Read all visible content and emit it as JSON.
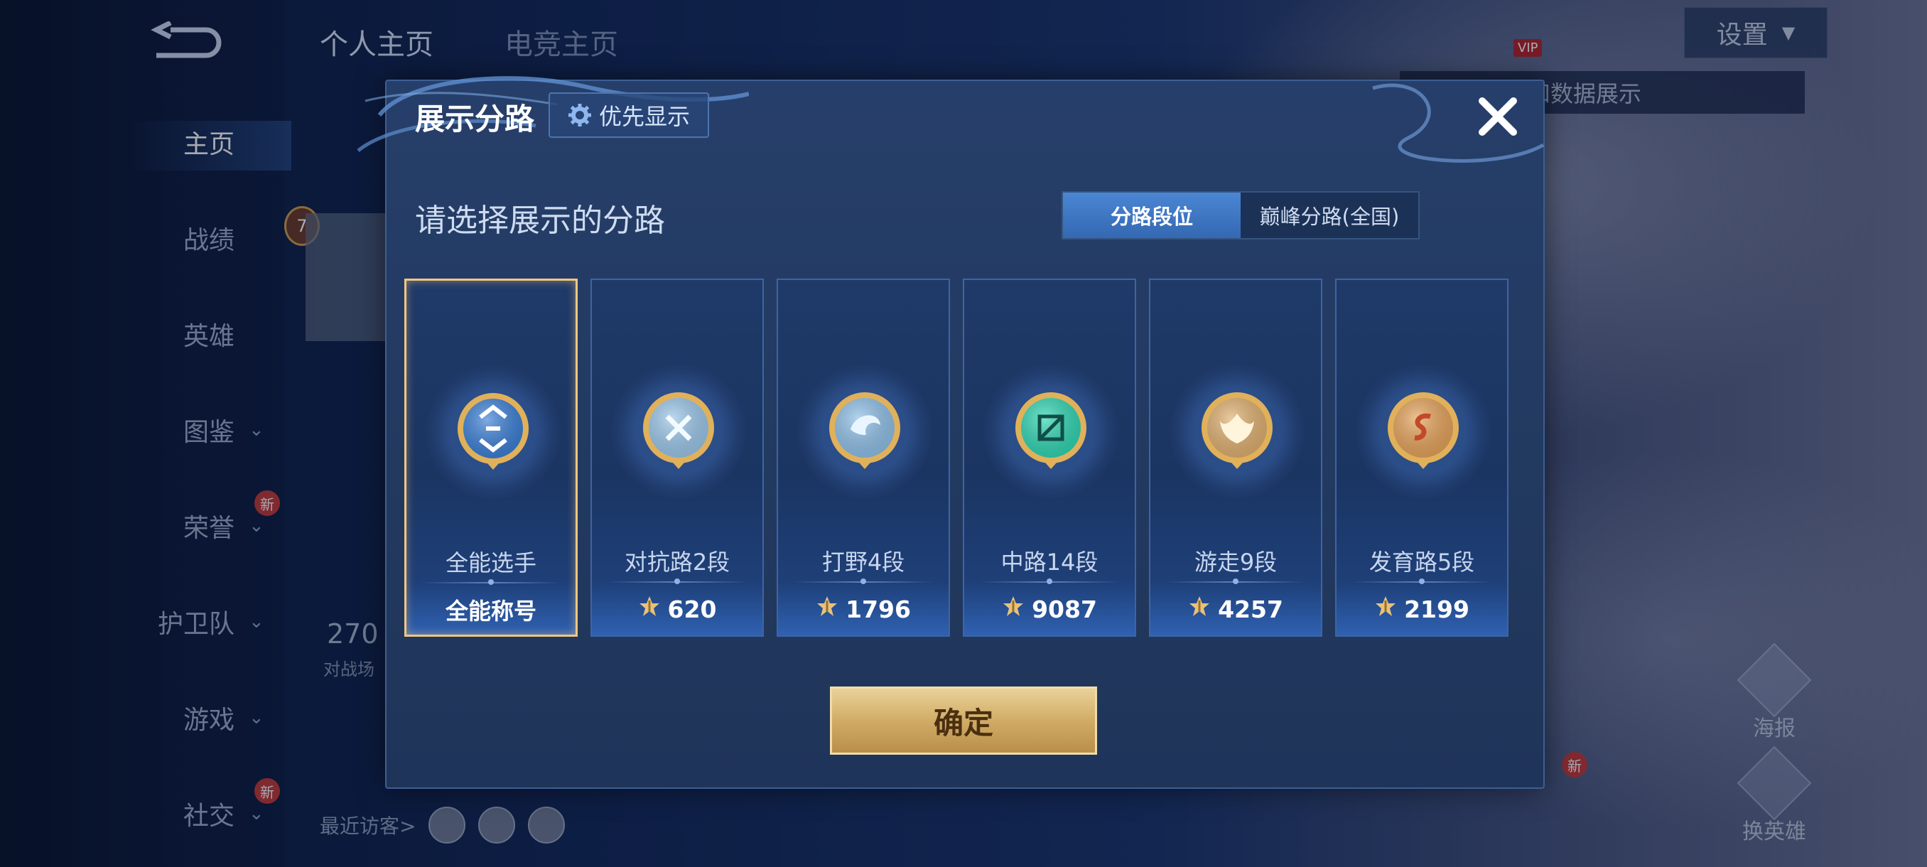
{
  "background": {
    "tabs": [
      "个人主页",
      "电竞主页"
    ],
    "nav": [
      {
        "label": "主页",
        "active": true,
        "chevron": false,
        "new": false
      },
      {
        "label": "战绩",
        "active": false,
        "chevron": false,
        "new": false
      },
      {
        "label": "英雄",
        "active": false,
        "chevron": false,
        "new": false
      },
      {
        "label": "图鉴",
        "active": false,
        "chevron": true,
        "new": false
      },
      {
        "label": "荣誉",
        "active": false,
        "chevron": true,
        "new": true
      },
      {
        "label": "护卫队",
        "active": false,
        "chevron": true,
        "new": false
      },
      {
        "label": "游戏",
        "active": false,
        "chevron": true,
        "new": false
      },
      {
        "label": "社交",
        "active": false,
        "chevron": true,
        "new": true
      }
    ],
    "new_badge": "新",
    "level_badge": "7",
    "stat_value": "270",
    "stat_label": "对战场",
    "recent_visitors": "最近访客>",
    "settings": "设置",
    "vip": "VIP",
    "hint": "以切换灵宝和数据展示",
    "side_buttons": [
      "海报",
      "换英雄"
    ]
  },
  "modal": {
    "title": "展示分路",
    "priority_button": "优先显示",
    "subtitle": "请选择展示的分路",
    "toggle": {
      "options": [
        "分路段位",
        "巅峰分路(全国)"
      ],
      "selected": 0
    },
    "lanes": [
      {
        "name": "全能选手",
        "value": "全能称号",
        "selected": true,
        "emblem": "all-round-emblem",
        "color": "#3a7fd6"
      },
      {
        "name": "对抗路2段",
        "value": "620",
        "selected": false,
        "emblem": "clash-lane-emblem",
        "color": "#9bc7ea"
      },
      {
        "name": "打野4段",
        "value": "1796",
        "selected": false,
        "emblem": "jungle-emblem",
        "color": "#8fc0e8"
      },
      {
        "name": "中路14段",
        "value": "9087",
        "selected": false,
        "emblem": "mid-lane-emblem",
        "color": "#2fd6b3"
      },
      {
        "name": "游走9段",
        "value": "4257",
        "selected": false,
        "emblem": "roam-emblem",
        "color": "#e0b070"
      },
      {
        "name": "发育路5段",
        "value": "2199",
        "selected": false,
        "emblem": "farm-lane-emblem",
        "color": "#e6a35a"
      }
    ],
    "confirm": "确定"
  }
}
